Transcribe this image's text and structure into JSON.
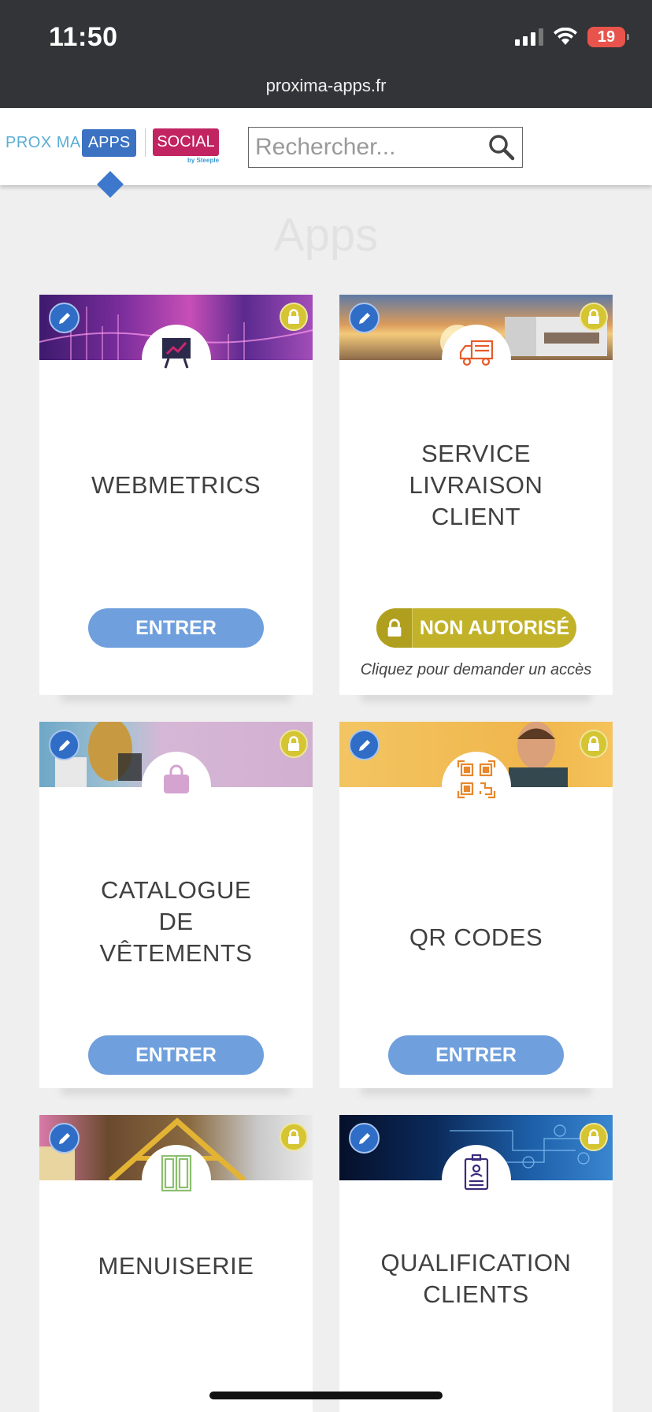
{
  "status_bar": {
    "time": "11:50",
    "battery": "19",
    "url": "proxima-apps.fr"
  },
  "header": {
    "brand": "PROX MA",
    "tab_apps": "APPS",
    "tab_social": "SOCIAL",
    "social_by": "by Steeple",
    "search_placeholder": "Rechercher..."
  },
  "page": {
    "title": "Apps"
  },
  "apps": [
    {
      "title_lines": [
        "WEBMETRICS"
      ],
      "button": "ENTRER",
      "icon": "presentation-chart-icon",
      "banner": "neon-data-banner",
      "authorized": true
    },
    {
      "title_lines": [
        "SERVICE",
        "LIVRAISON",
        "CLIENT"
      ],
      "button": "NON AUTORISÉ",
      "request_text": "Cliquez pour demander un accès",
      "icon": "delivery-truck-icon",
      "banner": "truck-sunset-banner",
      "authorized": false
    },
    {
      "title_lines": [
        "CATALOGUE",
        "DE",
        "VÊTEMENTS"
      ],
      "button": "ENTRER",
      "icon": "shopping-bag-icon",
      "banner": "fashion-shopping-banner",
      "authorized": true
    },
    {
      "title_lines": [
        "QR CODES"
      ],
      "button": "ENTRER",
      "icon": "qr-code-icon",
      "banner": "smiling-man-banner",
      "authorized": true
    },
    {
      "title_lines": [
        "MENUISERIE"
      ],
      "icon": "door-icon",
      "banner": "carpentry-tools-banner"
    },
    {
      "title_lines": [
        "QUALIFICATION",
        "CLIENTS"
      ],
      "icon": "id-badge-icon",
      "banner": "network-blue-banner"
    }
  ],
  "colors": {
    "status_bar_bg": "#333437",
    "apps_tab": "#3b72c2",
    "social_tab": "#c22462",
    "enter_button": "#6f9fdc",
    "denied_button": "#c2b22a",
    "lock_badge": "#d5c533",
    "edit_badge": "#2f6dc6"
  }
}
